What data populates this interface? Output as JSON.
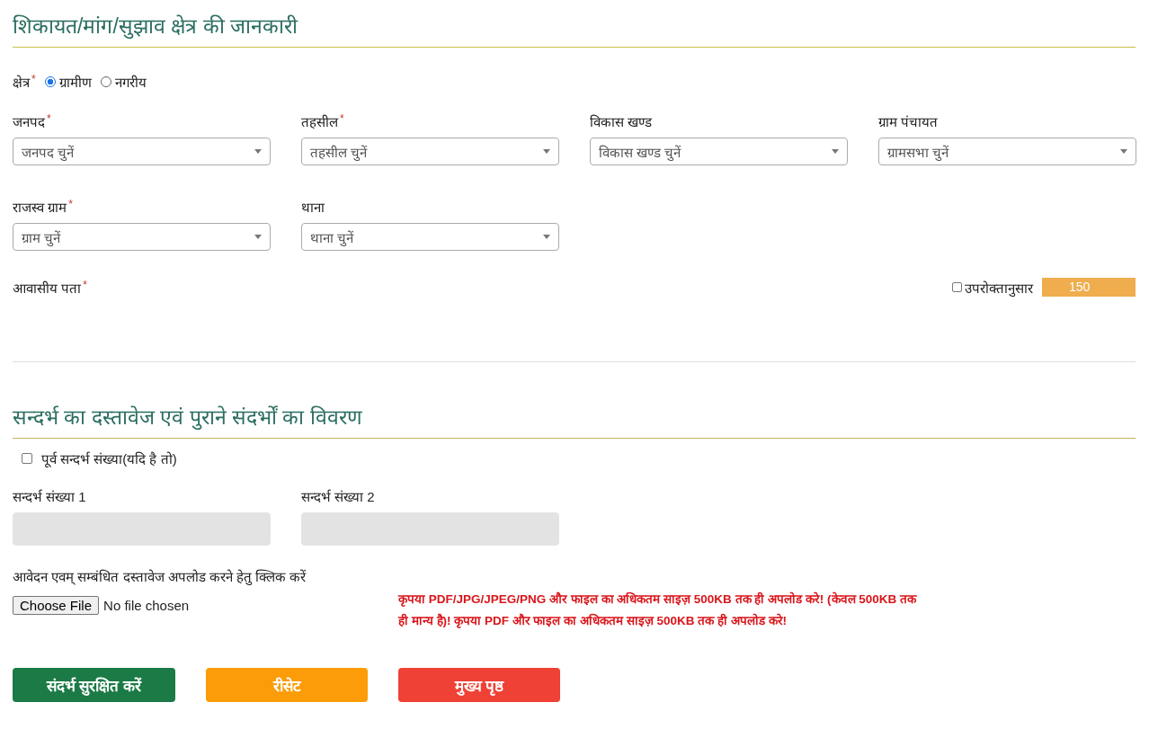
{
  "location_section": {
    "title": "शिकायत/मांग/सुझाव क्षेत्र की जानकारी",
    "area": {
      "label": "क्षेत्र",
      "mark": "*",
      "options": [
        {
          "label": "ग्रामीण",
          "selected": true
        },
        {
          "label": "नगरीय",
          "selected": false
        }
      ]
    },
    "fields": [
      {
        "label": "जनपद",
        "mark": "*",
        "value": "जनपद चुनें"
      },
      {
        "label": "तहसील",
        "mark": "*",
        "value": "तहसील चुनें"
      },
      {
        "label": "विकास खण्ड",
        "value": "विकास खण्ड चुनें"
      },
      {
        "label": "ग्राम पंचायत",
        "value": "ग्रामसभा चुनें"
      },
      {
        "label": "राजस्व ग्राम",
        "mark": "*",
        "value": "ग्राम चुनें"
      },
      {
        "label": "थाना",
        "value": "थाना चुनें"
      }
    ],
    "address": {
      "label": "आवासीय पता",
      "mark": "*",
      "same_as_above": {
        "label": "उपरोक्तानुसार",
        "checked": false
      },
      "counter": "150"
    }
  },
  "reference_section": {
    "title": "सन्दर्भ का दस्तावेज एवं पुराने संदर्भों का विवरण",
    "previous_reference": {
      "label": "पूर्व सन्दर्भ संख्या(यदि है तो)",
      "checked": false
    },
    "reference_fields": [
      {
        "label": "सन्दर्भ संख्या 1",
        "disabled": true
      },
      {
        "label": "सन्दर्भ संख्या 2",
        "disabled": true
      }
    ],
    "upload": {
      "label": "आवेदन एवम् सम्बंधित दस्तावेज अपलोड करने हेतु क्लिक करें",
      "button": "Choose File",
      "status": "No file chosen",
      "note": "कृपया PDF/JPG/JPEG/PNG और फाइल का अधिकतम साइज़ 500KB तक ही अपलोड करे! (केवल 500KB तक ही मान्य है)! कृपया PDF और फाइल का अधिकतम साइज़ 500KB तक ही अपलोड करे!"
    },
    "buttons": [
      {
        "label": "संदर्भ सुरक्षित करें",
        "kind": "save"
      },
      {
        "label": "रीसेट",
        "kind": "reset"
      },
      {
        "label": "मुख्य पृष्ठ",
        "kind": "home"
      }
    ]
  }
}
